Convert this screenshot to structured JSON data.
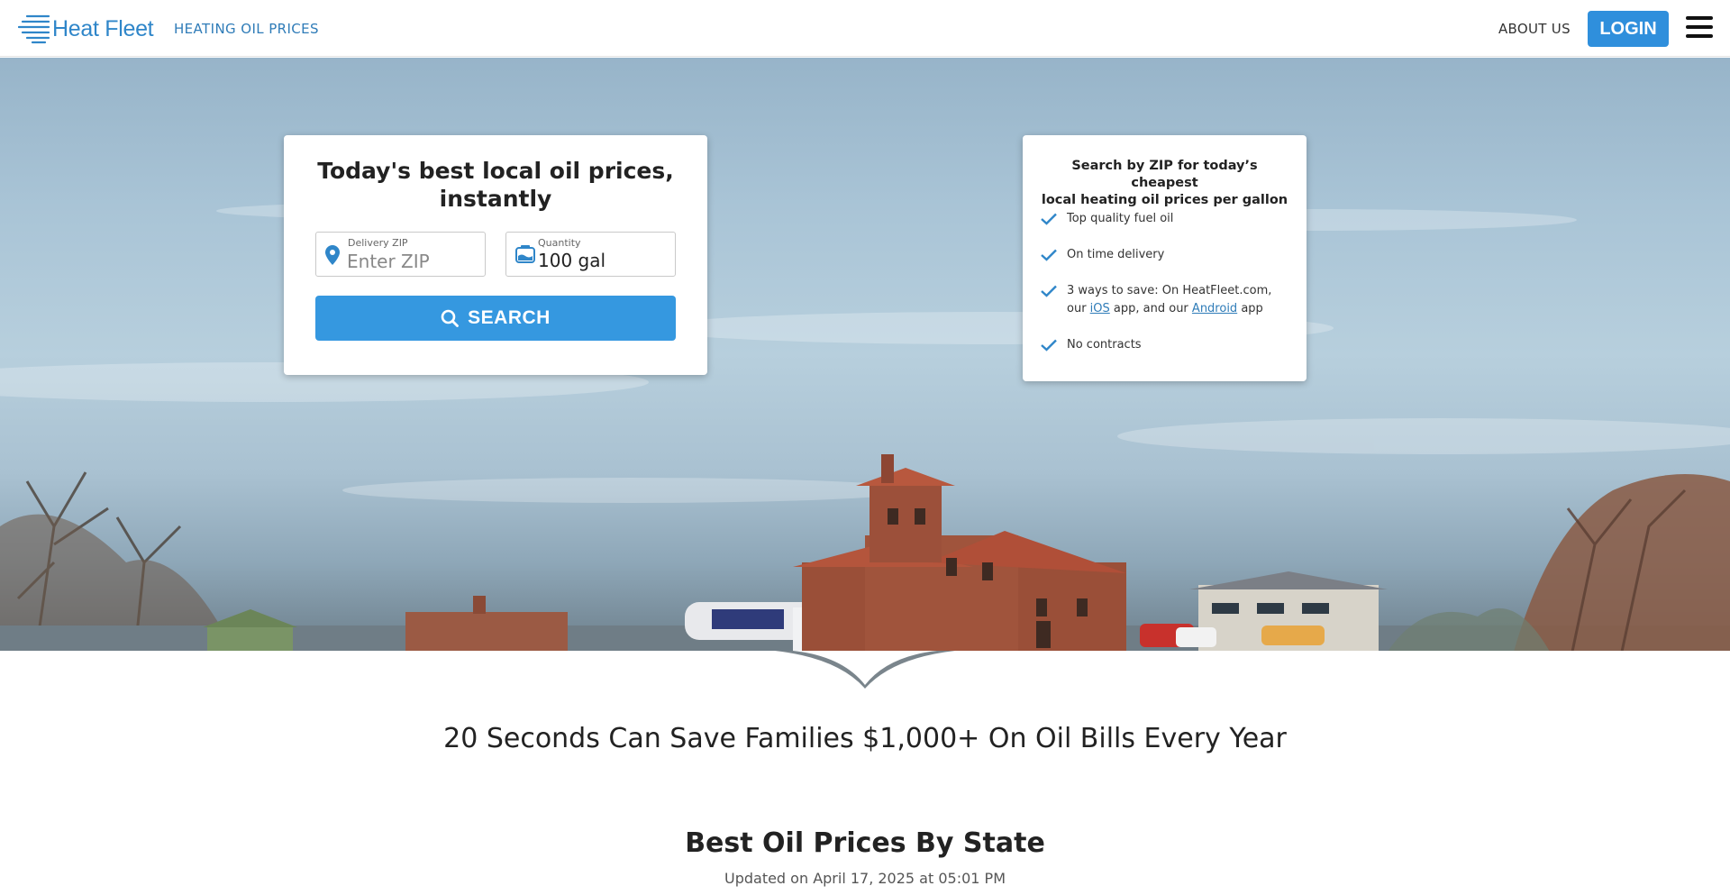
{
  "nav": {
    "logo_text": "Heat Fleet",
    "prices_link": "HEATING OIL PRICES",
    "about_link": "ABOUT US",
    "login_label": "LOGIN",
    "menu_icon": "hamburger-icon",
    "brand_color": "#2f86c9"
  },
  "search": {
    "title_line1": "Today's best local oil prices,",
    "title_line2": "instantly",
    "zip_label": "Delivery ZIP",
    "zip_placeholder": "Enter ZIP",
    "zip_value": "",
    "zip_icon": "location-pin-icon",
    "qty_label": "Quantity",
    "qty_value": "100 gal",
    "qty_icon": "fuel-tank-icon",
    "button_label": "SEARCH",
    "button_icon": "search-icon",
    "button_color": "#3598e0"
  },
  "info": {
    "title_line1": "Search by ZIP for today’s cheapest",
    "title_line2": "local heating oil prices per gallon",
    "items": [
      {
        "text": "Top quality fuel oil"
      },
      {
        "text": "On time delivery"
      },
      {
        "text_pre": "3 ways to save: On HeatFleet.com, our ",
        "link1": "iOS",
        "text_mid": " app, and our ",
        "link2": "Android",
        "text_post": " app"
      },
      {
        "text": "No contracts"
      }
    ],
    "check_icon": "checkmark-icon",
    "check_color": "#2f86c9"
  },
  "tagline": "20 Seconds Can Save Families $1,000+ On Oil Bills Every Year",
  "prices_section": {
    "title": "Best Oil Prices By State",
    "updated": "Updated on April 17, 2025 at 05:01 PM"
  }
}
